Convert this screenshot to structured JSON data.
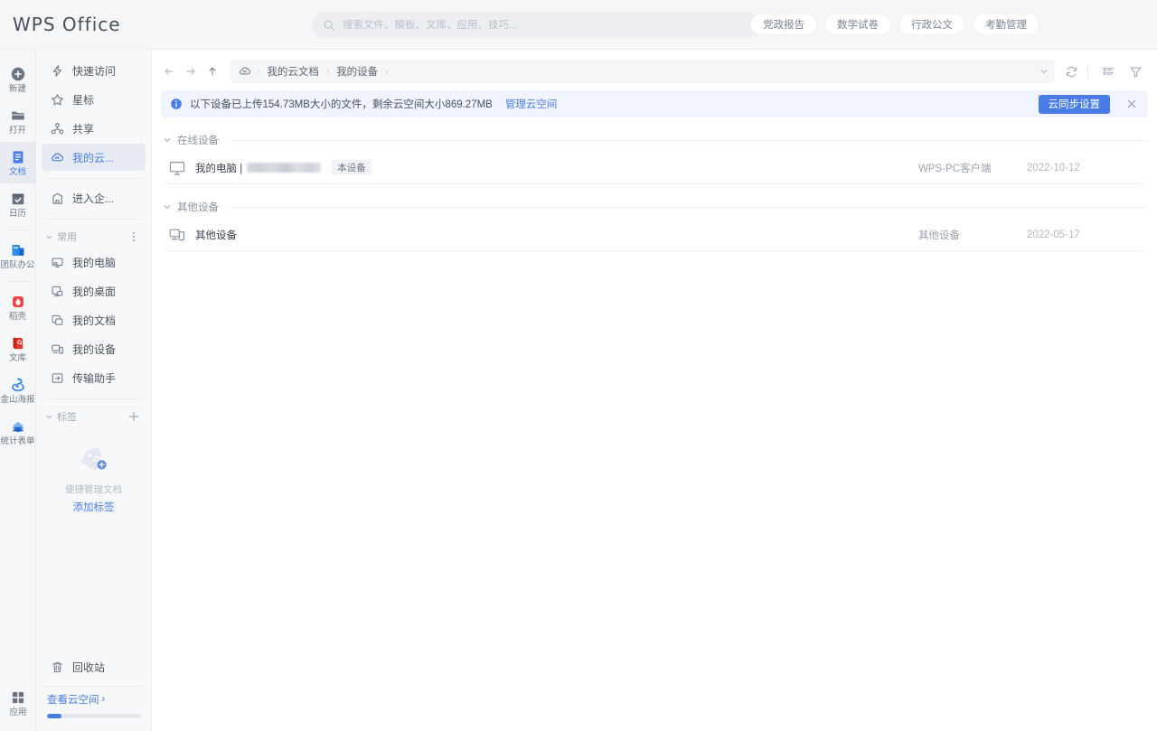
{
  "app": {
    "brand": "WPS Office"
  },
  "search": {
    "placeholder": "搜索文件、模板、文库、应用、技巧...",
    "value": ""
  },
  "quicklinks": [
    {
      "label": "党政报告"
    },
    {
      "label": "数学试卷"
    },
    {
      "label": "行政公文"
    },
    {
      "label": "考勤管理"
    }
  ],
  "rail": {
    "items": [
      {
        "label": "新建",
        "icon": "plus-circle-icon",
        "active": false
      },
      {
        "label": "打开",
        "icon": "folder-open-icon",
        "active": false
      },
      {
        "label": "文档",
        "icon": "document-icon",
        "active": true
      },
      {
        "label": "日历",
        "icon": "calendar-icon",
        "active": false
      },
      {
        "label": "团队办公",
        "icon": "team-office-icon",
        "active": false
      },
      {
        "label": "稻壳",
        "icon": "docer-icon",
        "active": false
      },
      {
        "label": "文库",
        "icon": "library-icon",
        "active": false
      },
      {
        "label": "金山海报",
        "icon": "poster-icon",
        "active": false
      },
      {
        "label": "统计表单",
        "icon": "form-icon",
        "active": false
      }
    ],
    "bottom": {
      "label": "应用",
      "icon": "apps-grid-icon"
    }
  },
  "sidebar": {
    "primary": [
      {
        "label": "快速访问",
        "icon": "lightning-icon",
        "active": false
      },
      {
        "label": "星标",
        "icon": "star-icon",
        "active": false
      },
      {
        "label": "共享",
        "icon": "share-icon",
        "active": false
      },
      {
        "label": "我的云...",
        "icon": "cloud-icon",
        "active": true
      }
    ],
    "enterprise": {
      "label": "进入企...",
      "icon": "enterprise-icon"
    },
    "common_section": {
      "label": "常用",
      "menu_icon": "more-vertical-icon"
    },
    "common": [
      {
        "label": "我的电脑",
        "icon": "my-computer-icon"
      },
      {
        "label": "我的桌面",
        "icon": "my-desktop-icon"
      },
      {
        "label": "我的文档",
        "icon": "my-documents-icon"
      },
      {
        "label": "我的设备",
        "icon": "my-devices-icon"
      },
      {
        "label": "传输助手",
        "icon": "transfer-icon"
      }
    ],
    "tag_section": {
      "label": "标签",
      "add_icon": "plus-icon"
    },
    "tag_empty": {
      "hint": "便捷管理文档",
      "action": "添加标签"
    },
    "recycle": {
      "label": "回收站",
      "icon": "trash-icon"
    },
    "cloud_space": {
      "label": "查看云空间",
      "arrow": "›",
      "usage_percent": 15
    }
  },
  "toolbar": {
    "back_icon": "arrow-left-icon",
    "forward_icon": "arrow-right-icon",
    "up_icon": "arrow-up-icon",
    "breadcrumb": [
      {
        "label": "我的云文档"
      },
      {
        "label": "我的设备"
      }
    ],
    "dropdown_icon": "chevron-down-icon",
    "refresh_icon": "refresh-icon",
    "view_icon": "list-view-icon",
    "filter_icon": "filter-icon"
  },
  "banner": {
    "icon": "info-icon",
    "text": "以下设备已上传154.73MB大小的文件，剩余云空间大小869.27MB",
    "link": "管理云空间",
    "button": "云同步设置",
    "close_icon": "close-icon"
  },
  "groups": [
    {
      "label": "在线设备",
      "rows": [
        {
          "icon": "monitor-icon",
          "name": "我的电脑 |",
          "redacted": true,
          "badge": "本设备",
          "type": "WPS-PC客户端",
          "date": "2022-10-12"
        }
      ]
    },
    {
      "label": "其他设备",
      "rows": [
        {
          "icon": "other-device-icon",
          "name": "其他设备",
          "redacted": false,
          "badge": "",
          "type": "其他设备",
          "date": "2022-05-17"
        }
      ]
    }
  ]
}
